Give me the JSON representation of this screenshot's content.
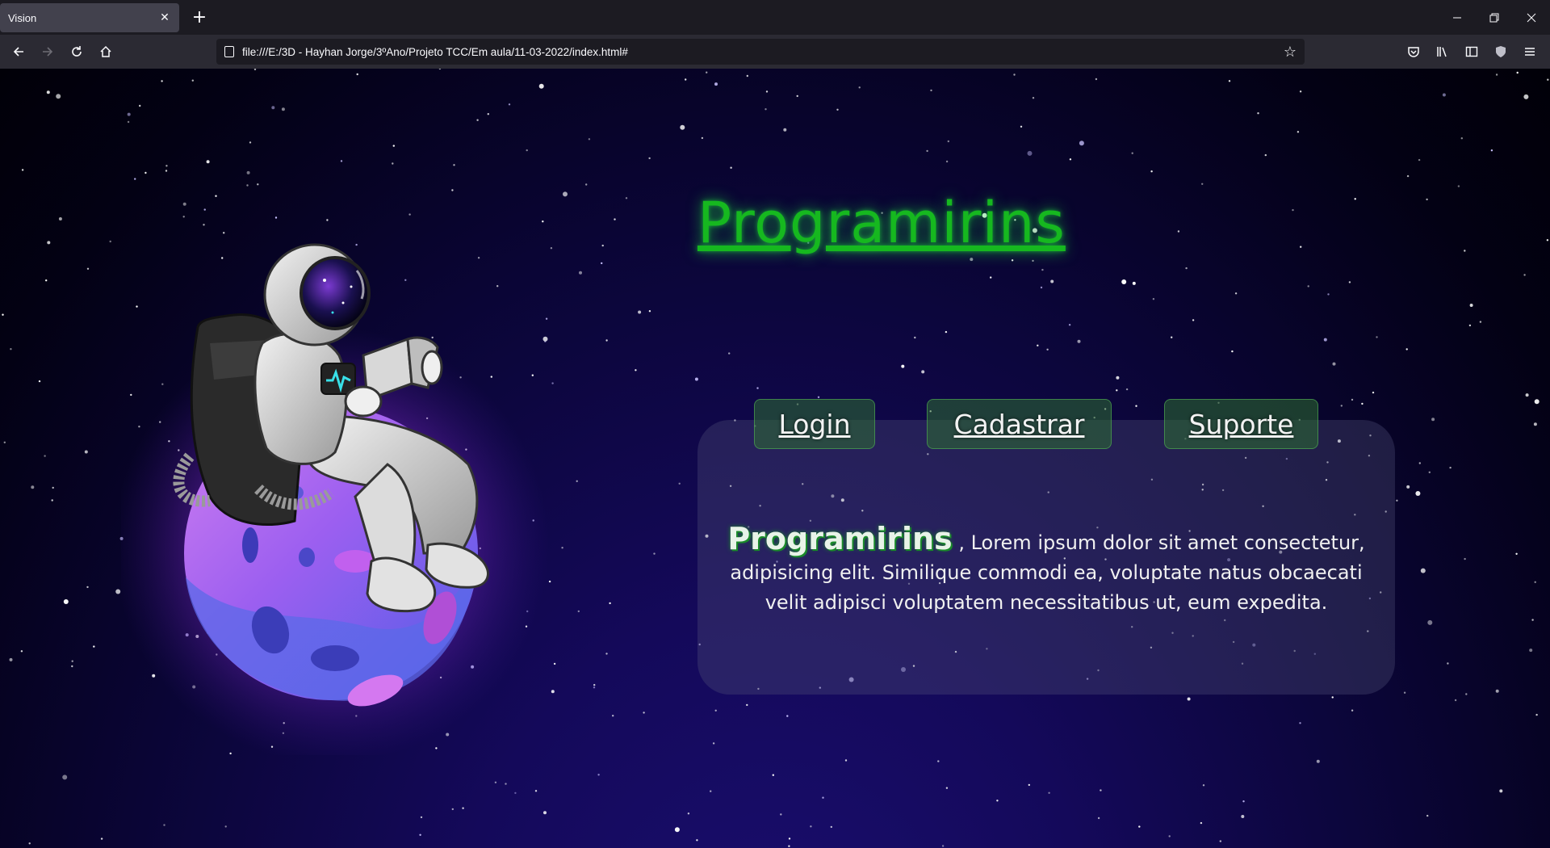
{
  "browser": {
    "tab_title": "Vision",
    "url": "file:///E:/3D - Hayhan Jorge/3ºAno/Projeto TCC/Em aula/11-03-2022/index.html#"
  },
  "page": {
    "title": "Programirins",
    "nav": [
      {
        "label": "Login"
      },
      {
        "label": "Cadastrar"
      },
      {
        "label": "Suporte"
      }
    ],
    "description": {
      "brand": "Programirins",
      "text": ", Lorem ipsum dolor sit amet consectetur, adipisicing elit. Similique commodi ea, voluptate natus obcaecati velit adipisci voluptatem necessitatibus ut, eum expedita."
    }
  },
  "colors": {
    "title_green": "#16b81f",
    "planet_purple": "#b14be0",
    "planet_blue": "#5b6ae8",
    "panel": "rgba(80,80,120,0.35)"
  },
  "icons": [
    "close-icon",
    "plus-icon",
    "back-icon",
    "forward-icon",
    "reload-icon",
    "home-icon",
    "page-icon",
    "bookmark-star-icon",
    "pocket-icon",
    "library-icon",
    "sidebar-icon",
    "shield-icon",
    "menu-icon",
    "minimize-icon",
    "restore-icon",
    "window-close-icon"
  ]
}
